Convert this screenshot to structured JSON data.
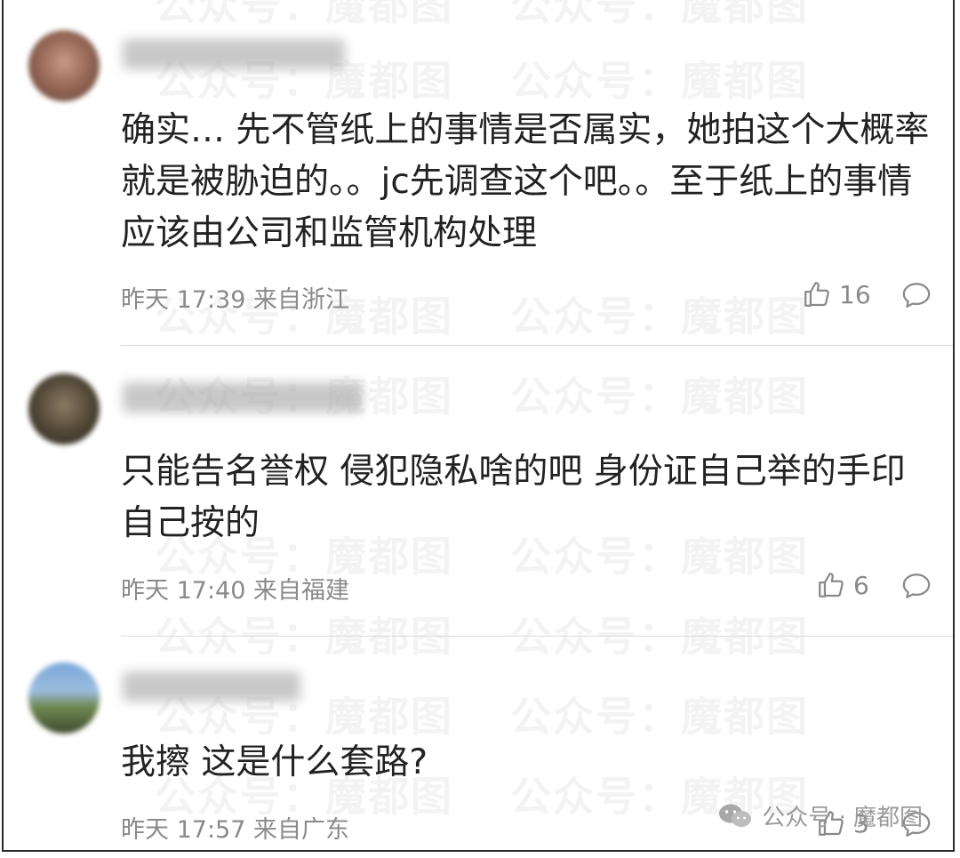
{
  "watermark": "公众号：魔都图",
  "brand": {
    "icon": "wechat-icon",
    "label": "公众号 · 魔都图"
  },
  "comments": [
    {
      "text": "确实… 先不管纸上的事情是否属实，她拍这个大概率就是被胁迫的。。jc先调查这个吧。。至于纸上的事情应该由公司和监管机构处理",
      "meta": "昨天 17:39 来自浙江",
      "likes": "16"
    },
    {
      "text": "只能告名誉权 侵犯隐私啥的吧 身份证自己举的手印自己按的",
      "meta": "昨天 17:40 来自福建",
      "likes": "6"
    },
    {
      "text": "我擦 这是什么套路?",
      "meta": "昨天 17:57 来自广东",
      "likes": "3"
    }
  ],
  "colors": {
    "text": "#222222",
    "meta": "#8a8a8a",
    "divider": "#dcdcdc"
  }
}
